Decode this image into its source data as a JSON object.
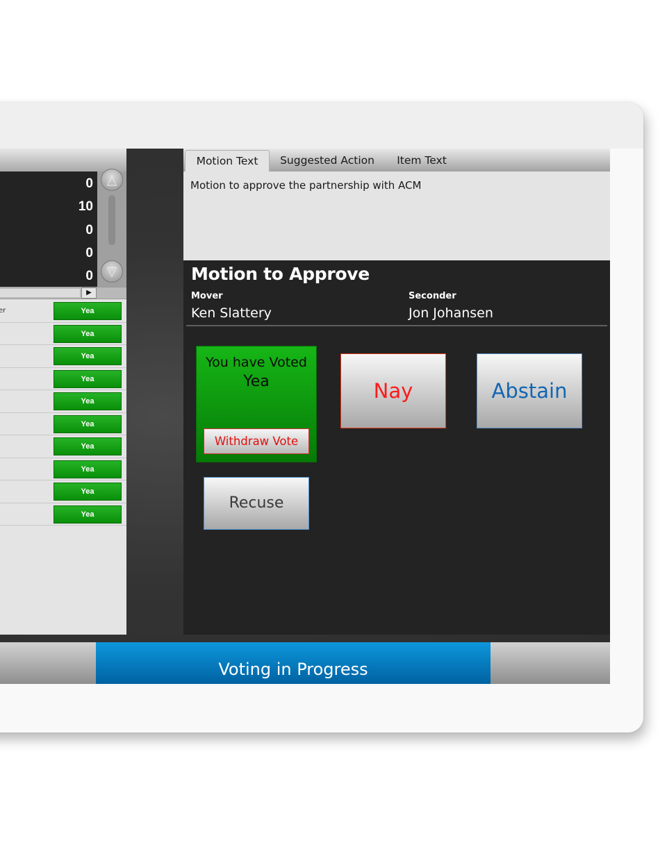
{
  "tally": {
    "values": [
      "0",
      "10",
      "0",
      "0",
      "0"
    ]
  },
  "vote_list": {
    "rows": [
      {
        "name": "er",
        "vote": "Yea"
      },
      {
        "name": "",
        "vote": "Yea"
      },
      {
        "name": "",
        "vote": "Yea"
      },
      {
        "name": "",
        "vote": "Yea"
      },
      {
        "name": "",
        "vote": "Yea"
      },
      {
        "name": "",
        "vote": "Yea"
      },
      {
        "name": "",
        "vote": "Yea"
      },
      {
        "name": "",
        "vote": "Yea"
      },
      {
        "name": "",
        "vote": "Yea"
      },
      {
        "name": "",
        "vote": "Yea"
      }
    ]
  },
  "tabs": {
    "motion_text": "Motion Text",
    "suggested_action": "Suggested Action",
    "item_text": "Item Text"
  },
  "motion_text": "Motion to approve the partnership with ACM",
  "motion": {
    "title": "Motion to Approve",
    "mover_label": "Mover",
    "mover_name": "Ken Slattery",
    "seconder_label": "Seconder",
    "seconder_name": "Jon Johansen"
  },
  "voting": {
    "voted_line1": "You have Voted",
    "voted_value": "Yea",
    "withdraw_label": "Withdraw Vote",
    "nay_label": "Nay",
    "abstain_label": "Abstain",
    "recuse_label": "Recuse"
  },
  "status": {
    "text": "Voting in Progress"
  },
  "colors": {
    "yea_green": "#0a8f0a",
    "nay_red": "#ff1a1a",
    "abstain_blue": "#1266b3",
    "status_blue": "#0a80c8"
  },
  "icons": {
    "scroll_up": "triangle-up-icon",
    "scroll_down": "triangle-down-icon",
    "scroll_right": "triangle-right-icon"
  }
}
